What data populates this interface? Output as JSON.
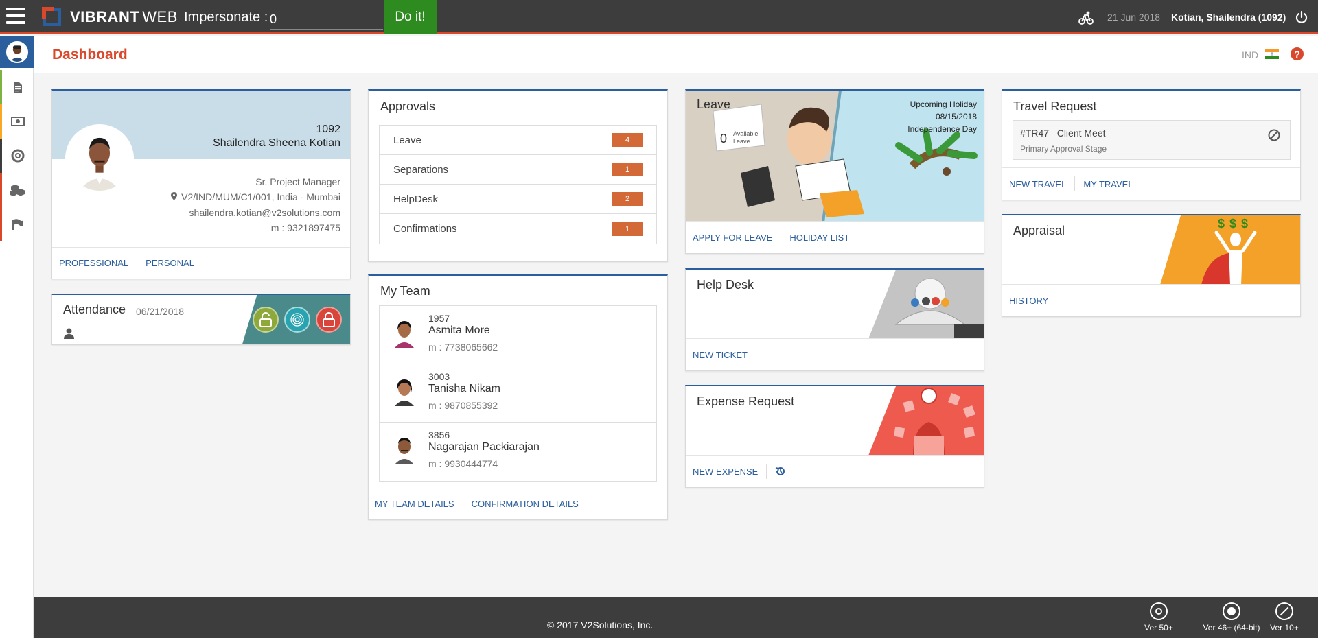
{
  "topbar": {
    "brand_bold": "VIBRANT",
    "brand_light": "WEB",
    "impersonate_label": "Impersonate :",
    "impersonate_value": "0",
    "do_it_label": "Do it!",
    "date": "21 Jun 2018",
    "user": "Kotian, Shailendra (1092)",
    "accent": "#d9482b"
  },
  "rail": {
    "items": [
      {
        "icon": "document-icon",
        "color": "#7cb342"
      },
      {
        "icon": "money-icon",
        "color": "#f9a825"
      },
      {
        "icon": "lifebuoy-icon",
        "color": "#3d3d3d"
      },
      {
        "icon": "boxes-icon",
        "color": "#d9482b"
      },
      {
        "icon": "flag-icon",
        "color": "#d9482b"
      }
    ]
  },
  "header": {
    "title": "Dashboard",
    "country": "IND",
    "help": "?"
  },
  "profile": {
    "id": "1092",
    "name": "Shailendra Sheena Kotian",
    "designation": "Sr. Project Manager",
    "location": "V2/IND/MUM/C1/001, India - Mumbai",
    "email": "shailendra.kotian@v2solutions.com",
    "mobile": "m : 9321897475",
    "links": [
      "PROFESSIONAL",
      "PERSONAL"
    ]
  },
  "attendance": {
    "title": "Attendance",
    "date": "06/21/2018",
    "lock_in": "0",
    "lock_out": "0"
  },
  "approvals": {
    "title": "Approvals",
    "rows": [
      {
        "label": "Leave",
        "count": "4"
      },
      {
        "label": "Separations",
        "count": "1"
      },
      {
        "label": "HelpDesk",
        "count": "2"
      },
      {
        "label": "Confirmations",
        "count": "1"
      }
    ]
  },
  "team": {
    "title": "My Team",
    "members": [
      {
        "id": "1957",
        "name": "Asmita More",
        "mobile": "m : 7738065662"
      },
      {
        "id": "3003",
        "name": "Tanisha Nikam",
        "mobile": "m : 9870855392"
      },
      {
        "id": "3856",
        "name": "Nagarajan Packiarajan",
        "mobile": "m : 9930444774"
      }
    ],
    "links": [
      "MY TEAM DETAILS",
      "CONFIRMATION DETAILS"
    ]
  },
  "leave": {
    "title": "Leave",
    "available_count": "0",
    "available_label_1": "Available",
    "available_label_2": "Leave",
    "holiday_heading": "Upcoming Holiday",
    "holiday_date": "08/15/2018",
    "holiday_name": "Independence Day",
    "links": [
      "APPLY FOR LEAVE",
      "HOLIDAY LIST"
    ]
  },
  "helpdesk": {
    "title": "Help Desk",
    "links": [
      "NEW TICKET"
    ]
  },
  "expense": {
    "title": "Expense Request",
    "links": [
      "NEW EXPENSE"
    ]
  },
  "travel": {
    "title": "Travel Request",
    "request_id": "#TR47",
    "request_name": "Client Meet",
    "stage": "Primary Approval Stage",
    "links": [
      "NEW TRAVEL",
      "MY TRAVEL"
    ]
  },
  "appraisal": {
    "title": "Appraisal",
    "dollars": "$ $ $",
    "links": [
      "HISTORY"
    ]
  },
  "footer": {
    "copyright": "© 2017 V2Solutions, Inc.",
    "browsers": [
      {
        "icon": "chrome-icon",
        "label": "Ver 50+"
      },
      {
        "icon": "firefox-icon",
        "label": "Ver 46+ (64-bit)"
      },
      {
        "icon": "safari-icon",
        "label": "Ver 10+"
      }
    ]
  }
}
